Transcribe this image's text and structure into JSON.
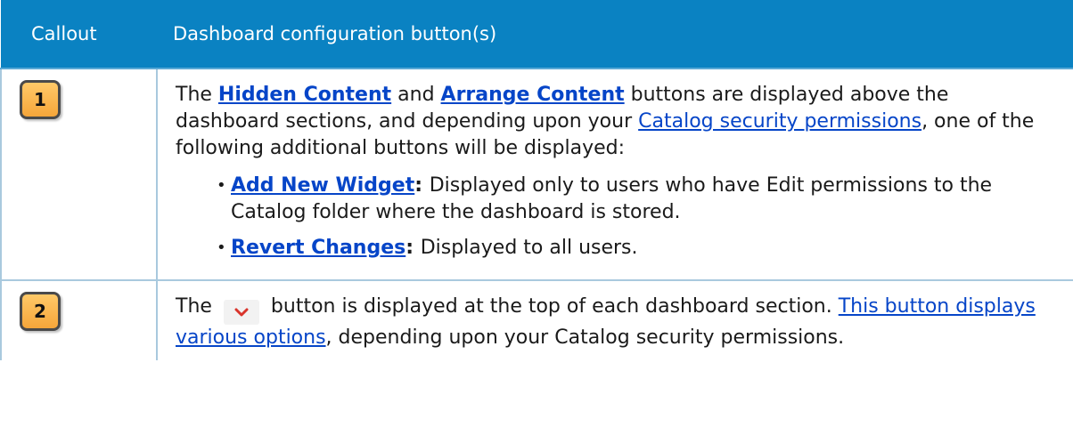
{
  "header": {
    "col1": "Callout",
    "col2": "Dashboard configuration button(s)"
  },
  "rows": [
    {
      "callout": "1",
      "p1": {
        "t1": "The ",
        "link1": "Hidden Content",
        "t2": " and ",
        "link2": "Arrange Content",
        "t3": " buttons are displayed above the dashboard sections, and depending upon your ",
        "link3": "Catalog security permissions",
        "t4": ", one of the following additional buttons will be displayed:"
      },
      "bullets": [
        {
          "link": "Add New Widget",
          "sep": ": ",
          "text": "Displayed only to users who have Edit permissions to the Catalog folder where the dashboard is stored."
        },
        {
          "link": "Revert Changes",
          "sep": ": ",
          "text": "Displayed to all users."
        }
      ]
    },
    {
      "callout": "2",
      "p1": {
        "t1": "The ",
        "icon": "chevron-down-icon",
        "t2": " button is displayed at the top of each dashboard section. ",
        "link1": "This button displays various options",
        "t3": ", depending upon your Catalog security permissions."
      }
    }
  ],
  "colors": {
    "header_bg": "#0a82c2",
    "link": "#0645c8",
    "badge": "#f6a63a",
    "chevron": "#d9342b"
  }
}
